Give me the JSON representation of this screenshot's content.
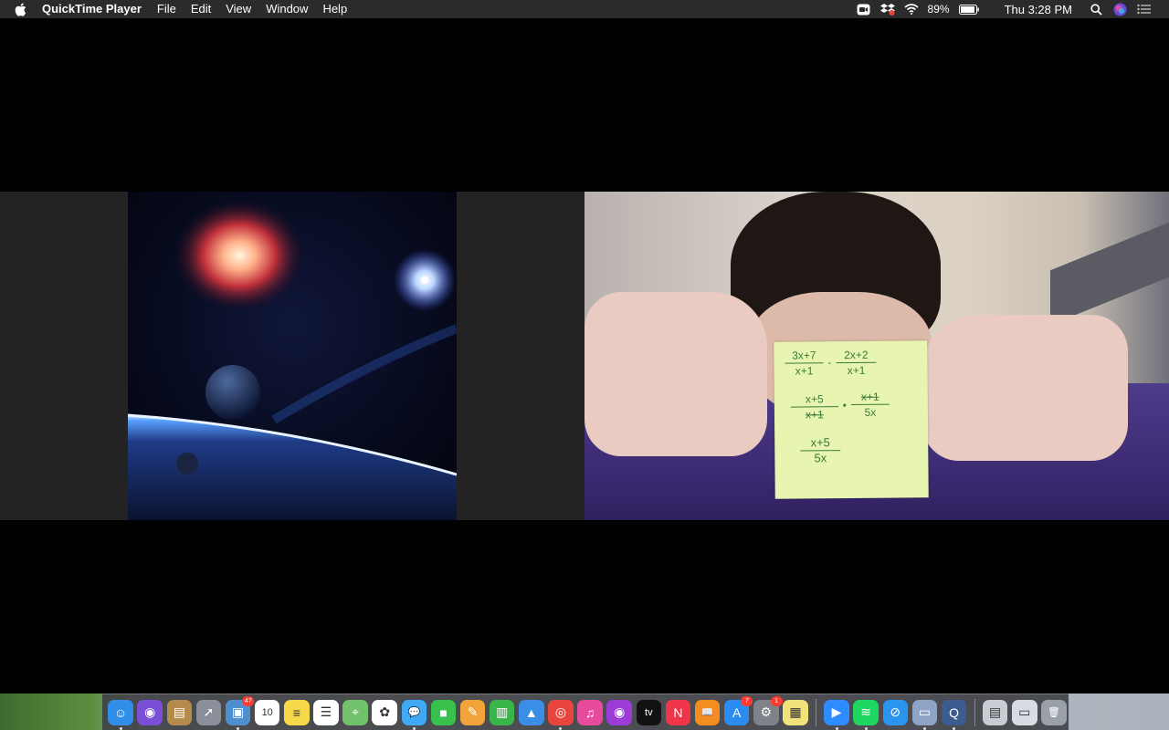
{
  "menubar": {
    "app_name": "QuickTime Player",
    "menus": [
      "File",
      "Edit",
      "View",
      "Window",
      "Help"
    ],
    "battery": "89%",
    "clock": "Thu 3:28 PM",
    "icons": [
      "apple-icon",
      "zoom-icon",
      "dropbox-icon",
      "wifi-icon",
      "battery-icon",
      "spotlight-icon",
      "siri-icon",
      "notification-center-icon"
    ]
  },
  "video": {
    "note_lines": {
      "l1_num_a": "3x+7",
      "l1_den_a": "x+1",
      "l1_op": "-",
      "l1_num_b": "2x+2",
      "l1_den_b": "x+1",
      "l2_num_a": "x+5",
      "l2_den_a": "x+1",
      "l2_op": "•",
      "l2_num_b": "x+1",
      "l2_den_b": "5x",
      "l3_num": "x+5",
      "l3_den": "5x"
    }
  },
  "dock": {
    "items": [
      {
        "name": "finder",
        "glyph": "☺",
        "color": "#2f8fe8",
        "running": true
      },
      {
        "name": "siri",
        "glyph": "◉",
        "color": "#7a4fd6",
        "running": false
      },
      {
        "name": "notefile",
        "glyph": "▤",
        "color": "#b58a4d",
        "running": false
      },
      {
        "name": "launchpad",
        "glyph": "➚",
        "color": "#8a8f99",
        "running": false
      },
      {
        "name": "preview-photo",
        "glyph": "▣",
        "color": "#4e8fd0",
        "running": true,
        "badge": "47"
      },
      {
        "name": "calendar",
        "glyph": "10",
        "color": "#ffffff",
        "running": false
      },
      {
        "name": "notes",
        "glyph": "≡",
        "color": "#f5d94b",
        "running": false
      },
      {
        "name": "reminders",
        "glyph": "☰",
        "color": "#ffffff",
        "running": false
      },
      {
        "name": "maps",
        "glyph": "⌖",
        "color": "#72c16b",
        "running": false
      },
      {
        "name": "photos",
        "glyph": "✿",
        "color": "#ffffff",
        "running": false
      },
      {
        "name": "messages",
        "glyph": "💬",
        "color": "#3fa9f5",
        "running": true
      },
      {
        "name": "facetime",
        "glyph": "■",
        "color": "#38c24d",
        "running": false
      },
      {
        "name": "pages",
        "glyph": "✎",
        "color": "#f2a33a",
        "running": false
      },
      {
        "name": "numbers",
        "glyph": "▥",
        "color": "#39b54a",
        "running": false
      },
      {
        "name": "keynote",
        "glyph": "▲",
        "color": "#3a8ee6",
        "running": false
      },
      {
        "name": "chrome",
        "glyph": "◎",
        "color": "#e8453c",
        "running": true
      },
      {
        "name": "itunes",
        "glyph": "♫",
        "color": "#e74c9c",
        "running": false
      },
      {
        "name": "podcasts",
        "glyph": "◉",
        "color": "#9b3cd6",
        "running": false
      },
      {
        "name": "apple-tv",
        "glyph": "tv",
        "color": "#111111",
        "running": false
      },
      {
        "name": "news",
        "glyph": "N",
        "color": "#f0354b",
        "running": false
      },
      {
        "name": "books",
        "glyph": "📖",
        "color": "#f28d21",
        "running": false
      },
      {
        "name": "app-store",
        "glyph": "A",
        "color": "#2a8cf0",
        "running": false,
        "badge": "7"
      },
      {
        "name": "system-preferences",
        "glyph": "⚙",
        "color": "#7f8288",
        "running": false,
        "badge": "1"
      },
      {
        "name": "stickies",
        "glyph": "▦",
        "color": "#f1e27a",
        "running": false
      },
      {
        "name": "sep1",
        "separator": true
      },
      {
        "name": "zoom",
        "glyph": "▶",
        "color": "#2d8cff",
        "running": true
      },
      {
        "name": "spotify",
        "glyph": "≋",
        "color": "#1ed760",
        "running": true
      },
      {
        "name": "safari",
        "glyph": "⊘",
        "color": "#2a95f0",
        "running": false
      },
      {
        "name": "image-capture",
        "glyph": "▭",
        "color": "#8ea4c6",
        "running": true
      },
      {
        "name": "quicktime",
        "glyph": "Q",
        "color": "#3a5c8f",
        "running": true
      },
      {
        "name": "sep2",
        "separator": true
      },
      {
        "name": "downloads-stack",
        "glyph": "▤",
        "color": "#c9cdd3",
        "running": false
      },
      {
        "name": "screenshot-stack",
        "glyph": "▭",
        "color": "#d8dde3",
        "running": false
      },
      {
        "name": "trash",
        "glyph": "🗑",
        "color": "#9aa0a8",
        "running": false
      }
    ]
  }
}
